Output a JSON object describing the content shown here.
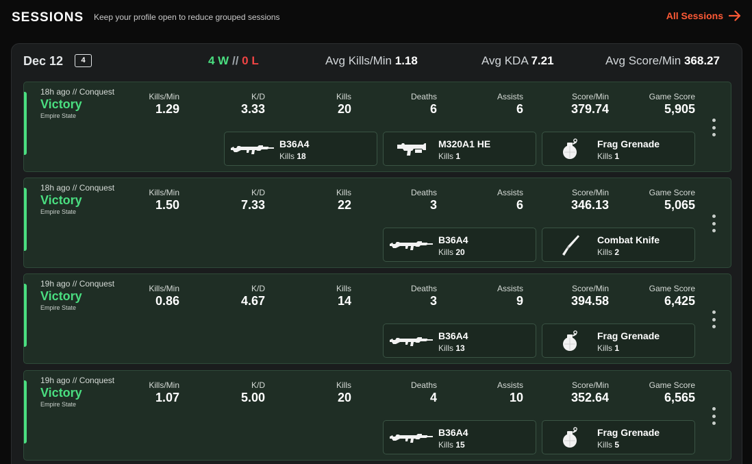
{
  "header": {
    "title": "SESSIONS",
    "subtitle": "Keep your profile open to reduce grouped sessions",
    "all_sessions_label": "All Sessions",
    "accent_color": "#ff5a36"
  },
  "day": {
    "date": "Dec 12",
    "count": "4",
    "wins": "4 W",
    "separator": "//",
    "losses": "0 L",
    "avg_kills_min_label": "Avg Kills/Min",
    "avg_kills_min": "1.18",
    "avg_kda_label": "Avg KDA",
    "avg_kda": "7.21",
    "avg_score_min_label": "Avg Score/Min",
    "avg_score_min": "368.27"
  },
  "stat_labels": {
    "kills_min": "Kills/Min",
    "kd": "K/D",
    "kills": "Kills",
    "deaths": "Deaths",
    "assists": "Assists",
    "score_min": "Score/Min",
    "game_score": "Game Score"
  },
  "weapon_kills_label": "Kills",
  "sessions": [
    {
      "meta": "18h ago // Conquest",
      "result": "Victory",
      "map": "Empire State",
      "kills_min": "1.29",
      "kd": "3.33",
      "kills": "20",
      "deaths": "6",
      "assists": "6",
      "score_min": "379.74",
      "game_score": "5,905",
      "weapons": [
        {
          "name": "B36A4",
          "kills": "18",
          "icon": "rifle-icon"
        },
        {
          "name": "M320A1 HE",
          "kills": "1",
          "icon": "grenade-launcher-icon"
        },
        {
          "name": "Frag Grenade",
          "kills": "1",
          "icon": "grenade-icon"
        }
      ]
    },
    {
      "meta": "18h ago // Conquest",
      "result": "Victory",
      "map": "Empire State",
      "kills_min": "1.50",
      "kd": "7.33",
      "kills": "22",
      "deaths": "3",
      "assists": "6",
      "score_min": "346.13",
      "game_score": "5,065",
      "weapons": [
        {
          "name": "B36A4",
          "kills": "20",
          "icon": "rifle-icon"
        },
        {
          "name": "Combat Knife",
          "kills": "2",
          "icon": "knife-icon"
        }
      ]
    },
    {
      "meta": "19h ago // Conquest",
      "result": "Victory",
      "map": "Empire State",
      "kills_min": "0.86",
      "kd": "4.67",
      "kills": "14",
      "deaths": "3",
      "assists": "9",
      "score_min": "394.58",
      "game_score": "6,425",
      "weapons": [
        {
          "name": "B36A4",
          "kills": "13",
          "icon": "rifle-icon"
        },
        {
          "name": "Frag Grenade",
          "kills": "1",
          "icon": "grenade-icon"
        }
      ]
    },
    {
      "meta": "19h ago // Conquest",
      "result": "Victory",
      "map": "Empire State",
      "kills_min": "1.07",
      "kd": "5.00",
      "kills": "20",
      "deaths": "4",
      "assists": "10",
      "score_min": "352.64",
      "game_score": "6,565",
      "weapons": [
        {
          "name": "B36A4",
          "kills": "15",
          "icon": "rifle-icon"
        },
        {
          "name": "Frag Grenade",
          "kills": "5",
          "icon": "grenade-icon"
        }
      ]
    }
  ]
}
